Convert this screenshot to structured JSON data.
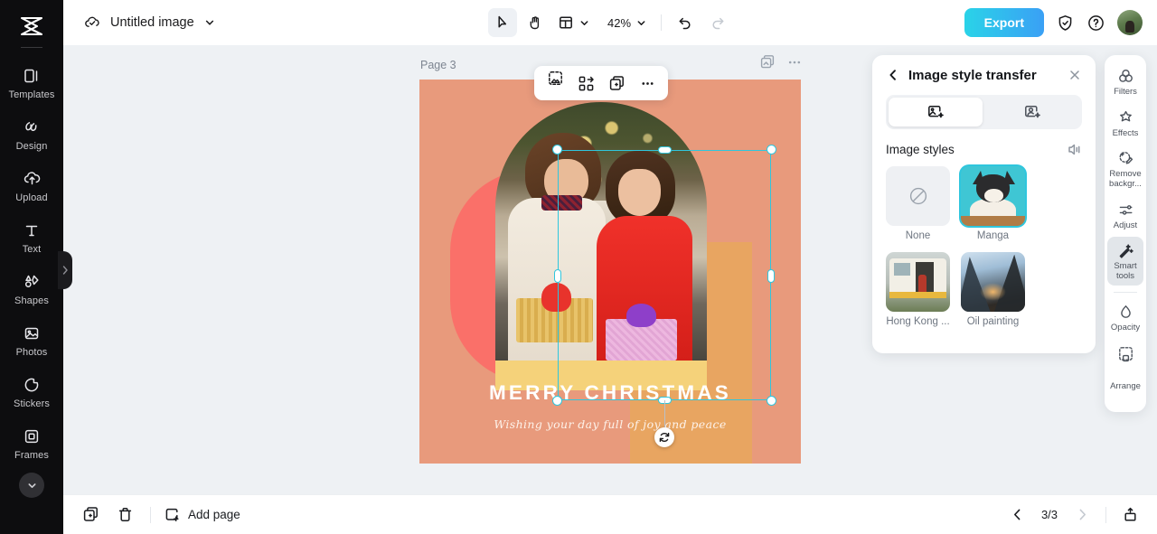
{
  "app": {
    "cloud_icon": "cloud-check-icon",
    "doc_title": "Untitled image",
    "title_caret": "chevron-down-icon"
  },
  "toolbar": {
    "select_icon": "cursor-arrow-icon",
    "hand_icon": "hand-icon",
    "layout_icon": "layout-icon",
    "layout_caret": "chevron-down-icon",
    "zoom_level": "42%",
    "zoom_caret": "chevron-down-icon",
    "undo_icon": "undo-icon",
    "redo_icon": "redo-icon",
    "export_label": "Export",
    "shield_icon": "shield-check-icon",
    "help_icon": "help-circle-icon",
    "avatar": "user-avatar"
  },
  "sidebar": {
    "logo": "capcut-logo-icon",
    "items": [
      {
        "label": "Templates",
        "icon": "templates-icon"
      },
      {
        "label": "Design",
        "icon": "design-icon"
      },
      {
        "label": "Upload",
        "icon": "upload-cloud-icon"
      },
      {
        "label": "Text",
        "icon": "text-icon"
      },
      {
        "label": "Shapes",
        "icon": "shapes-icon"
      },
      {
        "label": "Photos",
        "icon": "photo-icon"
      },
      {
        "label": "Stickers",
        "icon": "sticker-icon"
      },
      {
        "label": "Frames",
        "icon": "frame-icon"
      }
    ],
    "more_icon": "chevron-down-icon",
    "collapse_icon": "chevron-right-icon"
  },
  "stage": {
    "page_label": "Page 3",
    "duplicate_page_icon": "duplicate-page-icon",
    "page_more_icon": "more-horizontal-icon",
    "float_toolbar": [
      {
        "icon": "crop-select-icon",
        "name": "cutout-tool"
      },
      {
        "icon": "replace-icon",
        "name": "replace-tool"
      },
      {
        "icon": "duplicate-icon",
        "name": "duplicate-tool"
      },
      {
        "icon": "more-horizontal-icon",
        "name": "more-tool"
      }
    ],
    "rotate_icon": "rotate-handle-icon"
  },
  "design": {
    "headline": "MERRY CHRISTMAS",
    "tagline": "Wishing your day full of joy and peace",
    "colors": {
      "background": "#e89a7c",
      "shape_red": "#fa7069",
      "shape_orange": "#e8a561",
      "band_yellow": "#f5d27a",
      "headline_color": "#ffffff"
    }
  },
  "panel": {
    "back_icon": "chevron-left-icon",
    "title": "Image style transfer",
    "close_icon": "close-icon",
    "tabs": [
      {
        "name": "image-style-tab",
        "icon": "image-sparkle-icon",
        "selected": true
      },
      {
        "name": "portrait-style-tab",
        "icon": "portrait-sparkle-icon",
        "selected": false
      }
    ],
    "section_title": "Image styles",
    "section_icon": "collapse-panel-icon",
    "styles": [
      {
        "label": "None",
        "thumb": "none-thumb",
        "selected": false
      },
      {
        "label": "Manga",
        "thumb": "manga-cat-thumb",
        "selected": true
      },
      {
        "label": "Hong Kong ...",
        "thumb": "hongkong-van-thumb",
        "selected": false
      },
      {
        "label": "Oil painting",
        "thumb": "oil-painting-thumb",
        "selected": false
      }
    ]
  },
  "right_tools": {
    "items": [
      {
        "label": "Filters",
        "icon": "filters-icon",
        "active": false
      },
      {
        "label": "Effects",
        "icon": "effects-icon",
        "active": false
      },
      {
        "label": "Remove backgr...",
        "icon": "remove-bg-icon",
        "active": false
      },
      {
        "label": "Adjust",
        "icon": "adjust-icon",
        "active": false
      },
      {
        "label": "Smart tools",
        "icon": "smart-tools-icon",
        "active": true
      },
      {
        "label": "Opacity",
        "icon": "opacity-icon",
        "active": false
      },
      {
        "label": "Arrange",
        "icon": "arrange-icon",
        "active": false
      }
    ]
  },
  "bottom": {
    "duplicate_icon": "duplicate-icon",
    "delete_icon": "trash-icon",
    "add_page_icon": "add-page-icon",
    "add_page_label": "Add page",
    "prev_icon": "chevron-left-icon",
    "page_indicator": "3/3",
    "next_icon": "chevron-right-icon",
    "present_icon": "present-icon"
  }
}
